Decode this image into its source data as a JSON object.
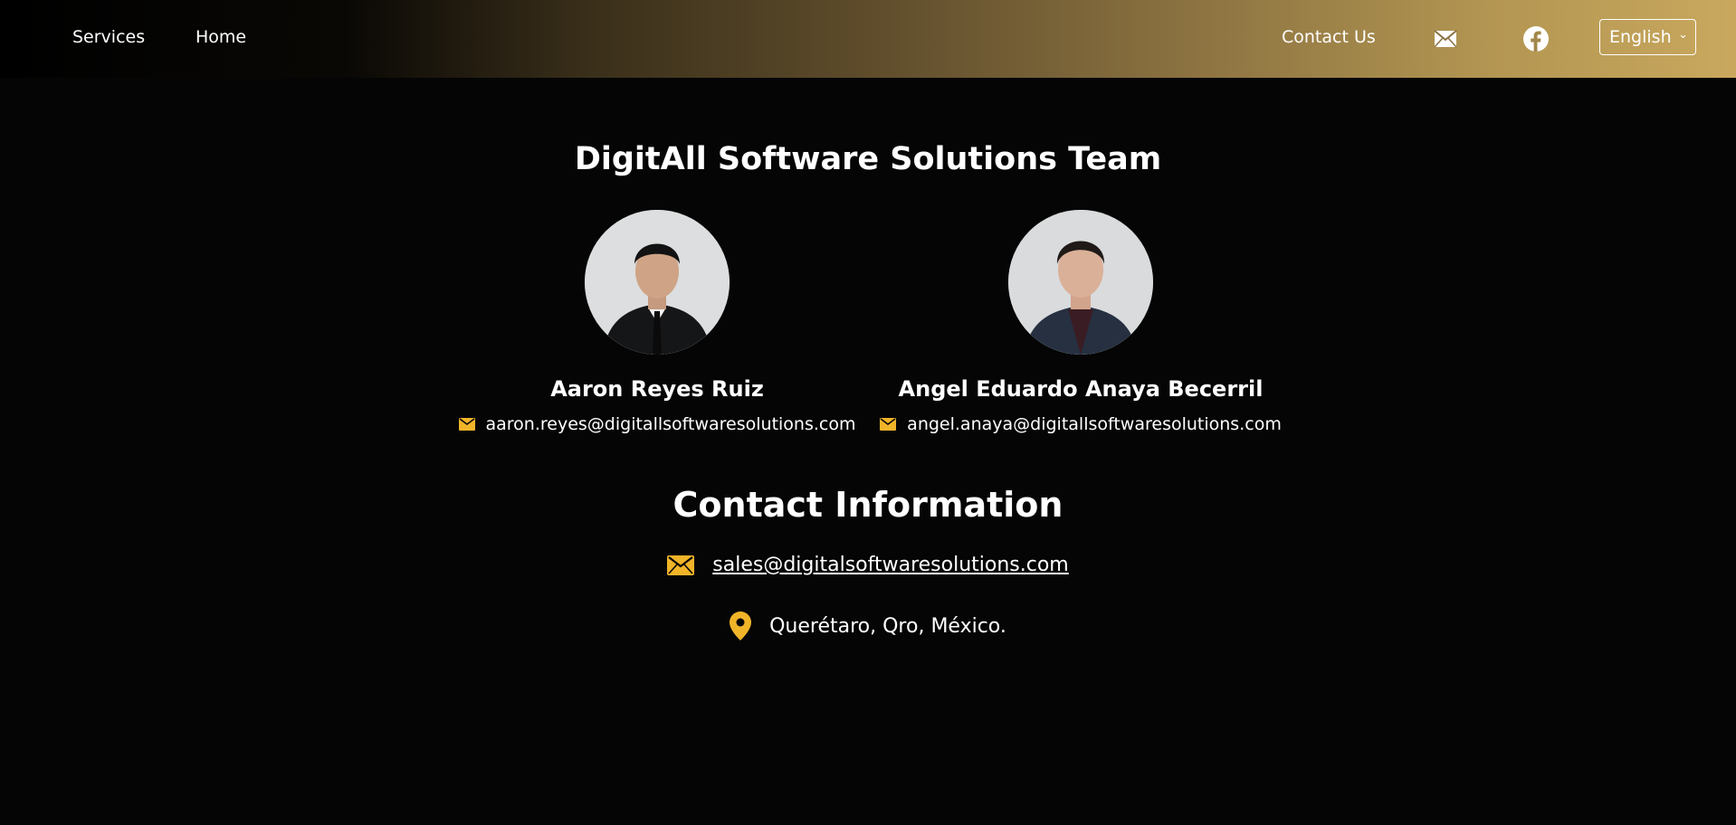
{
  "nav": {
    "services": "Services",
    "home": "Home",
    "contact_us": "Contact Us",
    "mail_icon": "mail-icon",
    "facebook_icon": "facebook-icon",
    "language": "English"
  },
  "team": {
    "title": "DigitAll Software Solutions Team",
    "members": [
      {
        "name": "Aaron Reyes Ruiz",
        "email": "aaron.reyes@digitallsoftwaresolutions.com"
      },
      {
        "name": "Angel Eduardo Anaya Becerril",
        "email": "angel.anaya@digitallsoftwaresolutions.com"
      }
    ]
  },
  "contact": {
    "title": "Contact Information",
    "email": "sales@digitalsoftwaresolutions.com",
    "location": "Querétaro, Qro, México."
  },
  "colors": {
    "accent": "#f0b429",
    "background": "#050505",
    "nav_gradient_end": "#c9a85e"
  }
}
